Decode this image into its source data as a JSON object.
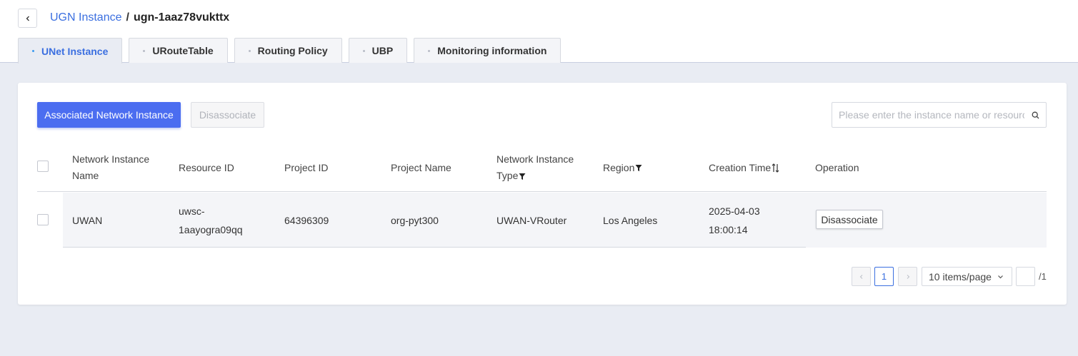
{
  "breadcrumb": {
    "parent": "UGN Instance",
    "separator": "/",
    "current": "ugn-1aaz78vukttx"
  },
  "tabs": [
    {
      "label": "UNet Instance",
      "active": true
    },
    {
      "label": "URouteTable",
      "active": false
    },
    {
      "label": "Routing Policy",
      "active": false
    },
    {
      "label": "UBP",
      "active": false
    },
    {
      "label": "Monitoring information",
      "active": false
    }
  ],
  "toolbar": {
    "associate_label": "Associated Network Instance",
    "disassociate_label": "Disassociate",
    "search_placeholder": "Please enter the instance name or resource ID"
  },
  "table": {
    "headers": {
      "name_line1": "Network Instance",
      "name_line2": "Name",
      "resource_id": "Resource ID",
      "project_id": "Project ID",
      "project_name": "Project Name",
      "type_line1": "Network Instance",
      "type_line2": "Type",
      "region": "Region",
      "creation_time": "Creation Time",
      "operation": "Operation"
    },
    "rows": [
      {
        "name": "UWAN",
        "resource_id_line1": "uwsc-",
        "resource_id_line2": "1aayogra09qq",
        "project_id": "64396309",
        "project_name": "org-pyt300",
        "type": "UWAN-VRouter",
        "region": "Los Angeles",
        "creation_date": "2025-04-03",
        "creation_clock": "18:00:14",
        "action": "Disassociate"
      }
    ]
  },
  "pagination": {
    "current_page": "1",
    "page_size": "10 items/page",
    "total_pages": "/1"
  },
  "colors": {
    "accent": "#3b6fe0",
    "primary_button": "#4b6df0",
    "page_background": "#e9ecf3"
  }
}
